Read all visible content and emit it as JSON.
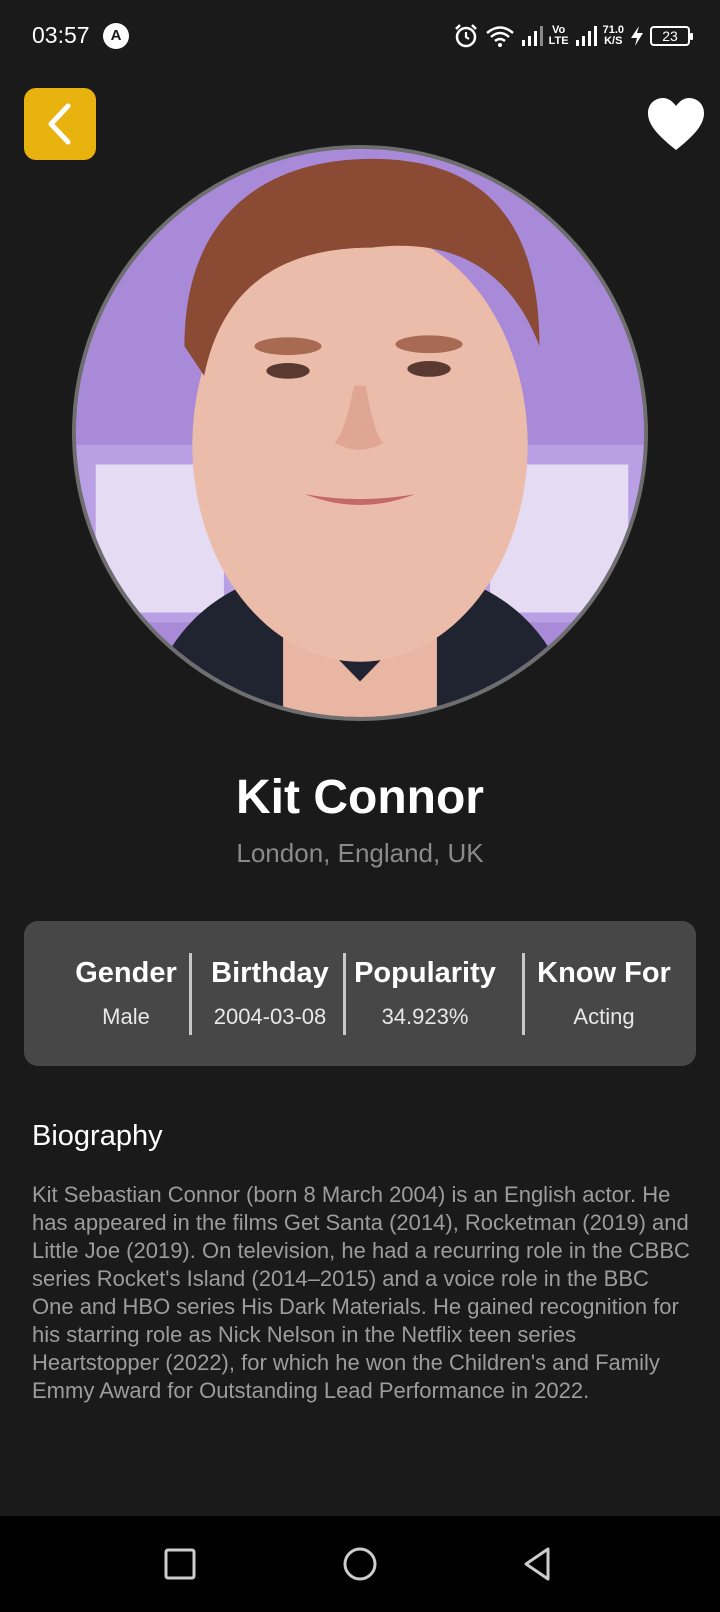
{
  "status_bar": {
    "time": "03:57",
    "net_speed_value": "71.0",
    "net_speed_unit": "K/S",
    "battery": "23",
    "volte": "Vo\nLTE"
  },
  "header": {
    "back_icon": "chevron-left-icon",
    "favorite_icon": "heart-icon",
    "accent_color": "#e8b20f"
  },
  "profile": {
    "name": "Kit Connor",
    "place_of_birth": "London, England, UK"
  },
  "info": [
    {
      "label": "Gender",
      "value": "Male"
    },
    {
      "label": "Birthday",
      "value": "2004-03-08"
    },
    {
      "label": "Popularity",
      "value": "34.923%"
    },
    {
      "label": "Know For",
      "value": "Acting"
    }
  ],
  "biography": {
    "heading": "Biography",
    "text": "Kit Sebastian Connor (born 8 March 2004) is an English actor. He has appeared in the films Get Santa (2014), Rocketman (2019) and Little Joe (2019). On television, he had a recurring role in the CBBC series Rocket's Island (2014–2015) and a voice role in the BBC One and HBO series His Dark Materials. He gained recognition for his starring role as Nick Nelson in the Netflix teen series Heartstopper (2022), for which he won the Children's and Family Emmy Award for Outstanding Lead Performance in 2022."
  },
  "nav": {
    "recents_icon": "square-icon",
    "home_icon": "circle-icon",
    "back_icon": "triangle-back-icon"
  }
}
